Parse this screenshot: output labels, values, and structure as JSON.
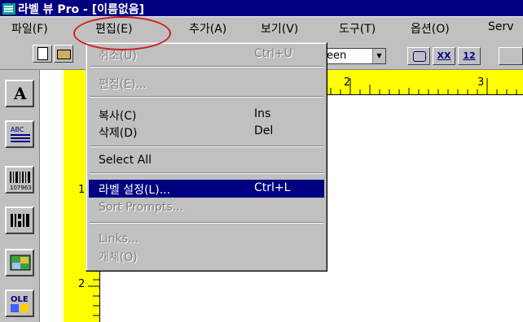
{
  "window": {
    "title": "라벨 뷰 Pro - [이름없음]"
  },
  "menubar": {
    "items": [
      {
        "label": "파일(F)"
      },
      {
        "label": "편집(E)"
      },
      {
        "label": "추가(A)"
      },
      {
        "label": "보기(V)"
      },
      {
        "label": "도구(T)"
      },
      {
        "label": "옵션(O)"
      },
      {
        "label": "Serv"
      }
    ]
  },
  "toolbar": {
    "combo_value": "een",
    "format_buttons": [
      "XX",
      "12"
    ]
  },
  "ruler": {
    "h_numbers": [
      "2",
      "3"
    ],
    "v_numbers": [
      "1",
      "2"
    ]
  },
  "edit_menu": {
    "items": [
      {
        "label": "취소(U)",
        "shortcut": "Ctrl+U"
      },
      {
        "label": "편집(E)..."
      },
      {
        "label": "복사(C)",
        "shortcut": "Ins"
      },
      {
        "label": "삭제(D)",
        "shortcut": "Del"
      },
      {
        "label": "Select All"
      },
      {
        "label": "라벨 설정(L)...",
        "shortcut": "Ctrl+L"
      },
      {
        "label": "Sort Prompts..."
      },
      {
        "label": "Links..."
      },
      {
        "label": "개체(O)"
      }
    ]
  },
  "tools": [
    {
      "icon": "text-tool-icon",
      "label": "A"
    },
    {
      "icon": "paragraph-tool-icon",
      "label": "ABC"
    },
    {
      "icon": "barcode-tool-icon",
      "label": "107963"
    },
    {
      "icon": "2d-barcode-tool-icon"
    },
    {
      "icon": "image-tool-icon"
    },
    {
      "icon": "ole-tool-icon",
      "label": "OLE"
    }
  ],
  "colors": {
    "title_bar": "#000080",
    "highlight": "#000080",
    "ruler": "#ffff00",
    "annotation_circle": "#d02020"
  }
}
